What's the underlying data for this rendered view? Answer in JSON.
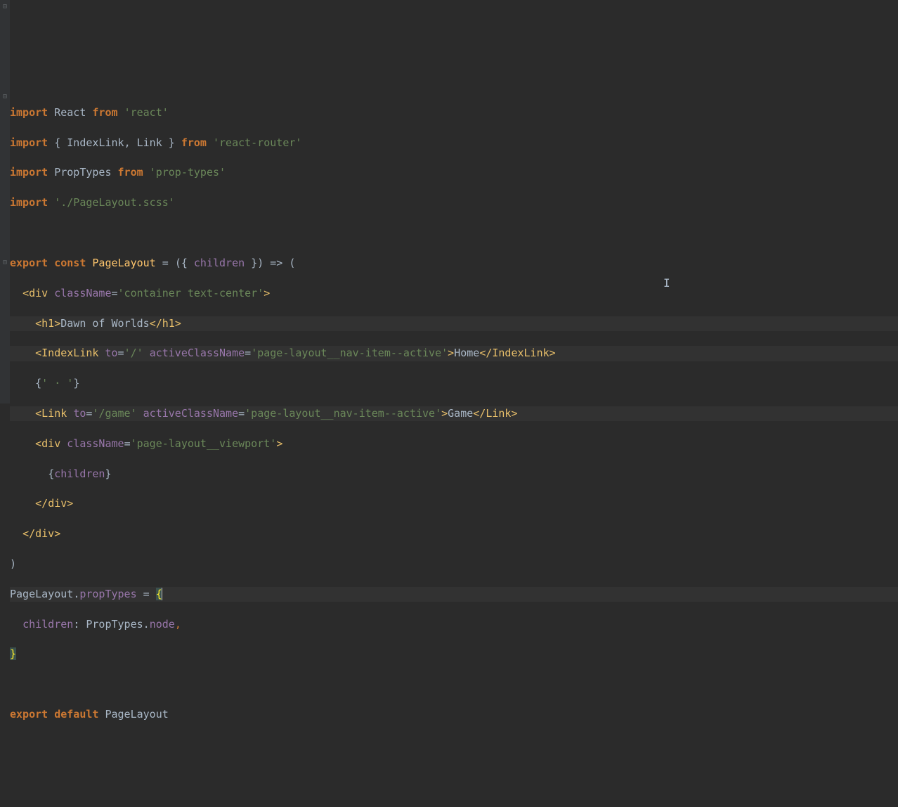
{
  "colors": {
    "background": "#2b2b2b",
    "gutter": "#313335",
    "lineHighlight": "#323232",
    "keyword": "#cc7832",
    "definition": "#ffc66d",
    "string": "#6a8759",
    "attribute": "#9876aa",
    "tag": "#e8bf6a",
    "default": "#a9b7c6",
    "matchedBrace": "#ffef28"
  },
  "tokens": {
    "import": "import",
    "from": "from",
    "export": "export",
    "const": "const",
    "default": "default",
    "React": "React",
    "IndexLink": "IndexLink",
    "Link": "Link",
    "PropTypes": "PropTypes",
    "PageLayout": "PageLayout",
    "children": "children",
    "className": "className",
    "to": "to",
    "activeClassName": "activeClassName",
    "propTypes": "propTypes",
    "node": "node",
    "div": "div",
    "h1": "h1"
  },
  "strings": {
    "react": "'react'",
    "reactRouter": "'react-router'",
    "propTypes": "'prop-types'",
    "scss": "'./PageLayout.scss'",
    "container": "'container text-center'",
    "root": "'/'",
    "navActive": "'page-layout__nav-item--active'",
    "game": "'/game'",
    "viewport": "'page-layout__viewport'",
    "sep": "' · '"
  },
  "text": {
    "dawn": "Dawn of Worlds",
    "home": "Home",
    "gameTxt": "Game"
  },
  "punct": {
    "lbrace": "{",
    "rbrace": "}",
    "lparen": "(",
    "rparen": ")",
    "arrow": "=>",
    "eq": "=",
    "comma": ",",
    "dot": ".",
    "colon": ":",
    "lt": "<",
    "gt": ">",
    "ltSlash": "</",
    "slashGt": "/>"
  }
}
